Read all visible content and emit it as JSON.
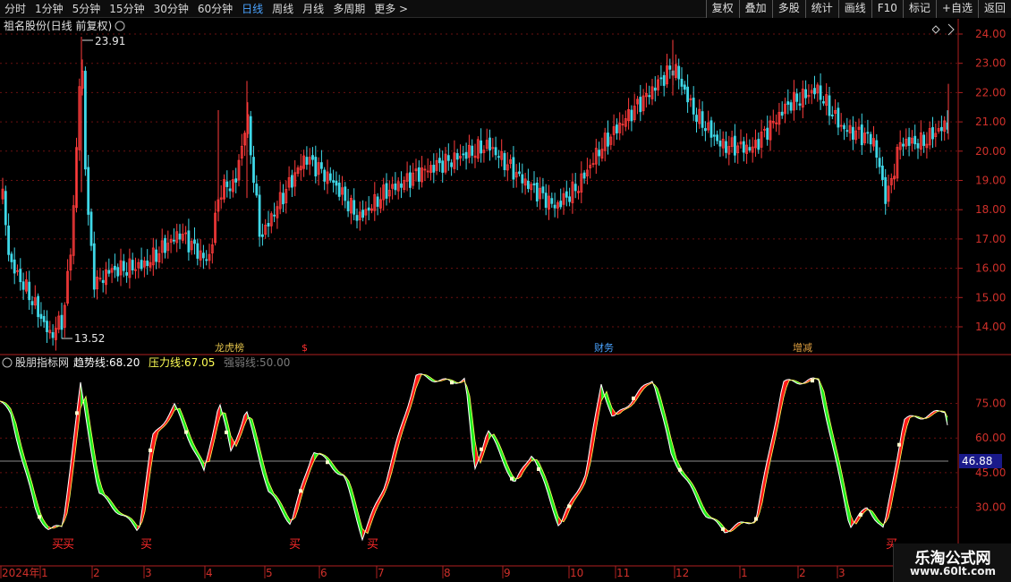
{
  "toolbar": {
    "timeframes": [
      "分时",
      "1分钟",
      "5分钟",
      "15分钟",
      "30分钟",
      "60分钟",
      "日线",
      "周线",
      "月线",
      "多周期",
      "更多 >"
    ],
    "active_index": 6,
    "tools": [
      "复权",
      "叠加",
      "多股",
      "统计",
      "画线",
      "F10",
      "标记",
      "+自选",
      "返回"
    ]
  },
  "main_chart": {
    "title": "祖名股份(日线 前复权)",
    "y_ticks": [
      "24.00",
      "23.00",
      "22.00",
      "21.00",
      "20.00",
      "19.00",
      "18.00",
      "17.00",
      "16.00",
      "15.00",
      "14.00"
    ],
    "max_label": "23.91",
    "min_label": "13.52",
    "markers": [
      {
        "text": "龙虎榜",
        "color": "#e0c04a"
      },
      {
        "text": "$",
        "color": "#ff3030"
      },
      {
        "text": "财务",
        "color": "#4aa3ff"
      },
      {
        "text": "增减",
        "color": "#e0a040"
      }
    ],
    "colors": {
      "up": "#ff3b3b",
      "down": "#3fd8e8"
    }
  },
  "indicator": {
    "name": "股朋指标网",
    "lines": [
      {
        "label": "趋势线:",
        "value": "68.20",
        "color": "#ffffff"
      },
      {
        "label": "压力线:",
        "value": "67.05",
        "color": "#ffff55"
      },
      {
        "label": "强弱线:",
        "value": "50.00",
        "color": "#7a7a7a"
      }
    ],
    "y_ticks": [
      "75.00",
      "60.00",
      "45.00",
      "30.00"
    ],
    "current_value": "46.88",
    "signal_label": "买",
    "fill_up_color": "#ff1a1a",
    "fill_down_color": "#22ee22"
  },
  "xaxis": {
    "labels": [
      "2024年",
      "1",
      "2",
      "3",
      "4",
      "5",
      "6",
      "7",
      "8",
      "9",
      "10",
      "11",
      "12",
      "1",
      "2",
      "3"
    ]
  },
  "watermark": {
    "title": "乐淘公式网",
    "url": "www.60lt.com"
  }
}
